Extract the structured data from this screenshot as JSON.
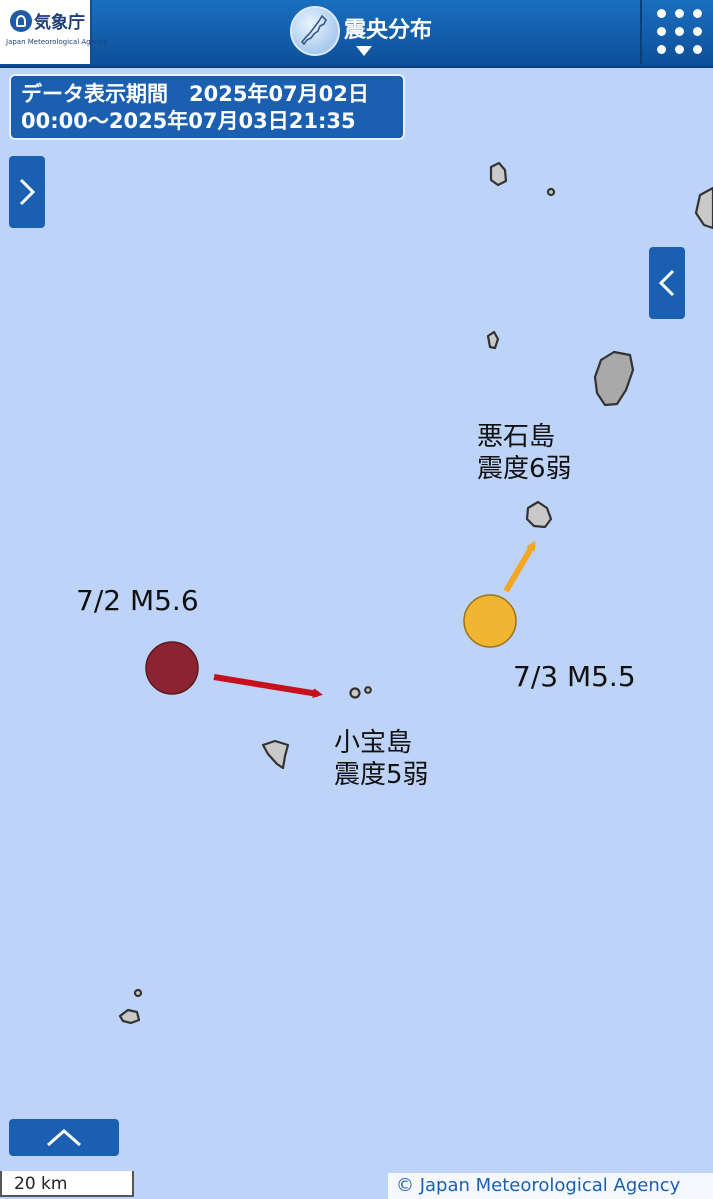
{
  "header": {
    "logo_name": "気象庁",
    "logo_sub": "Japan Meteorological Agency",
    "title": "震央分布"
  },
  "period": {
    "line1": "データ表示期間　2025年07月02日",
    "line2": "00:00～2025年07月03日21:35"
  },
  "map": {
    "labels": {
      "akuseki": [
        "悪石島",
        "震度6弱"
      ],
      "kodakara": [
        "小宝島",
        "震度5弱"
      ],
      "quake1": "7/2 M5.6",
      "quake2": "7/3 M5.5"
    },
    "colors": {
      "sea": "#bdd3f7",
      "quake1": "#8b2430",
      "quake2": "#f2b531",
      "arrow1": "#c8101c",
      "arrow2": "#f5a623"
    }
  },
  "footer": {
    "scale": "20 km",
    "copyright": "© Japan Meteorological Agency"
  }
}
